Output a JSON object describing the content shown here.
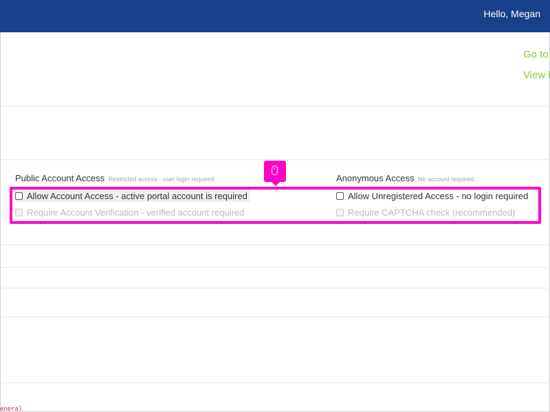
{
  "header": {
    "greeting": "Hello, Megan",
    "bg_color": "#18418c"
  },
  "side_links": [
    {
      "label": "Go to"
    },
    {
      "label": "View l"
    }
  ],
  "public_access": {
    "title": "Public Account Access",
    "hint": "Restricted access - user login required",
    "options": [
      {
        "label": "Allow Account Access - active portal account is required",
        "checked": false,
        "enabled": true
      },
      {
        "label": "Require Account Verification - verified account required",
        "checked": false,
        "enabled": false
      }
    ]
  },
  "anonymous_access": {
    "title": "Anonymous Access",
    "hint": "No account required.",
    "options": [
      {
        "label": "Allow Unregistered Access - no login required",
        "checked": false,
        "enabled": true
      },
      {
        "label": "Require CAPTCHA check (recommended)",
        "checked": false,
        "enabled": false
      }
    ]
  },
  "highlight": {
    "color": "#ff00c8",
    "marker_icon": "mouse-icon"
  },
  "footer": {
    "corner_text": "eneral"
  }
}
